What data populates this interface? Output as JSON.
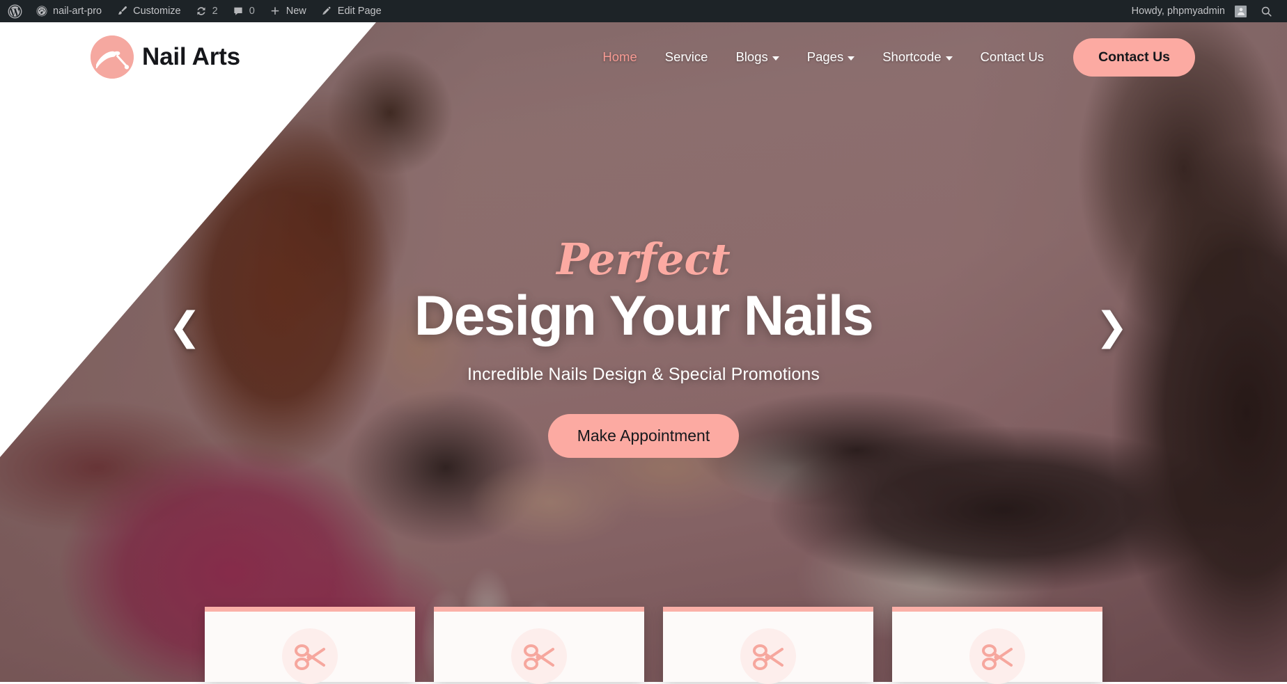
{
  "adminbar": {
    "wp_logo_icon": "wordpress-logo-icon",
    "items": [
      {
        "icon": "dashboard-icon",
        "label": "nail-art-pro"
      },
      {
        "icon": "brush-icon",
        "label": "Customize"
      },
      {
        "icon": "updates-icon",
        "label": "2"
      },
      {
        "icon": "comment-bubble-icon",
        "label": "0"
      },
      {
        "icon": "plus-icon",
        "label": "New"
      },
      {
        "icon": "pencil-icon",
        "label": "Edit Page"
      }
    ],
    "greeting": "Howdy, phpmyadmin",
    "avatar_icon": "user-avatar-icon",
    "search_icon": "search-icon"
  },
  "header": {
    "brand_name": "Nail Arts",
    "logo_icon": "nail-hand-logo-icon",
    "nav": [
      {
        "label": "Home",
        "has_caret": false,
        "active": true
      },
      {
        "label": "Service",
        "has_caret": false,
        "active": false
      },
      {
        "label": "Blogs",
        "has_caret": true,
        "active": false
      },
      {
        "label": "Pages",
        "has_caret": true,
        "active": false
      },
      {
        "label": "Shortcode",
        "has_caret": true,
        "active": false
      },
      {
        "label": "Contact Us",
        "has_caret": false,
        "active": false
      }
    ],
    "cta_label": "Contact Us"
  },
  "hero": {
    "eyebrow": "Perfect",
    "title": "Design Your Nails",
    "subtitle": "Incredible Nails Design & Special Promotions",
    "button_label": "Make Appointment",
    "prev_arrow": "❮",
    "next_arrow": "❯"
  },
  "cards": [
    {
      "icon": "scissors-icon"
    },
    {
      "icon": "scissors-icon"
    },
    {
      "icon": "scissors-icon"
    },
    {
      "icon": "scissors-icon"
    }
  ],
  "colors": {
    "accent_pink": "#fcaaa2",
    "accent_pink_light": "#fdeeec",
    "card_top_border": "#fbb0a8",
    "admin_bar_bg": "#1d2327",
    "admin_bar_text": "#c3c4c7",
    "brand_text": "#15161a",
    "hero_text": "#ffffff"
  }
}
